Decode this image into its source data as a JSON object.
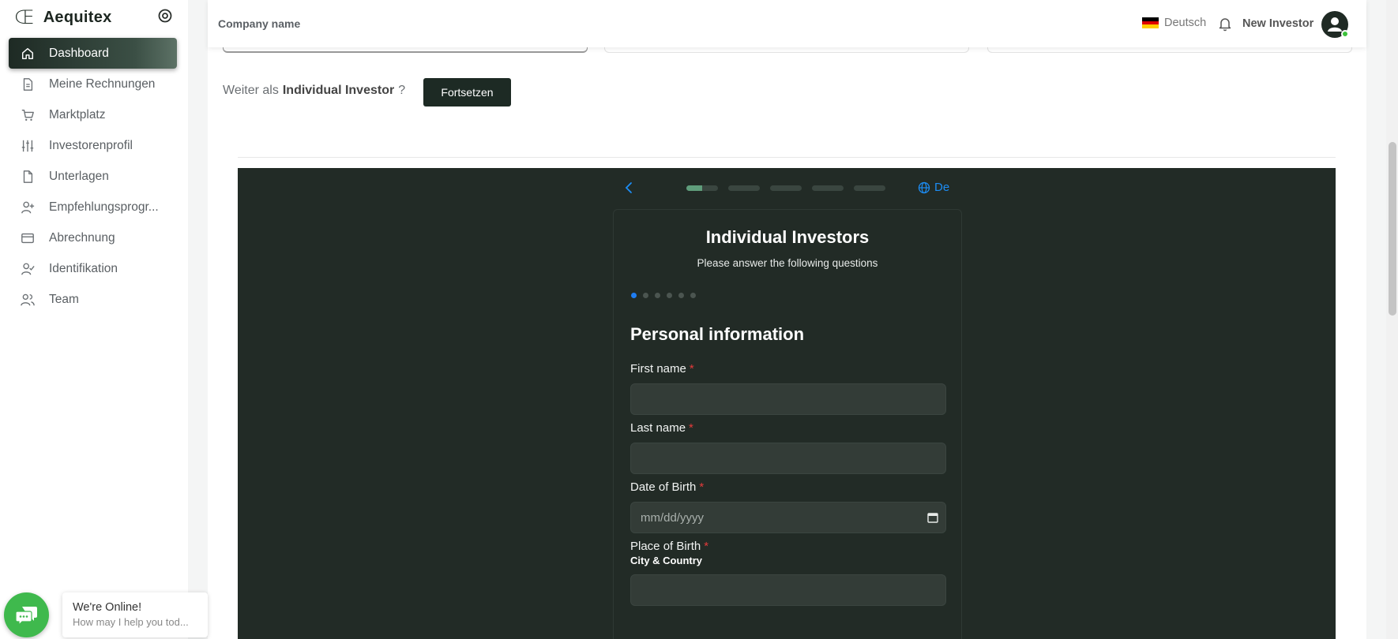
{
  "brand": {
    "logo": "Œ",
    "name": "Aequitex"
  },
  "sidebar": {
    "items": [
      {
        "key": "dashboard",
        "label": "Dashboard",
        "active": true
      },
      {
        "key": "invoices",
        "label": "Meine Rechnungen"
      },
      {
        "key": "marketplace",
        "label": "Marktplatz"
      },
      {
        "key": "investor-profile",
        "label": "Investorenprofil"
      },
      {
        "key": "documents",
        "label": "Unterlagen"
      },
      {
        "key": "referral",
        "label": "Empfehlungsprogr..."
      },
      {
        "key": "billing",
        "label": "Abrechnung"
      },
      {
        "key": "identification",
        "label": "Identifikation"
      },
      {
        "key": "team",
        "label": "Team"
      }
    ]
  },
  "header": {
    "company_label": "Company name",
    "language": "Deutsch",
    "user_name": "New Investor"
  },
  "continue": {
    "prefix": "Weiter als",
    "role": "Individual Investor",
    "suffix": "?",
    "button": "Fortsetzen"
  },
  "embed": {
    "language": "De",
    "progress_steps": [
      0.5,
      0,
      0,
      0,
      0
    ],
    "title": "Individual Investors",
    "subtitle": "Please answer the following questions",
    "page_dots": 6,
    "page_active": 1,
    "section_title": "Personal information",
    "fields": {
      "first_name": {
        "label": "First name",
        "required_mark": "*"
      },
      "last_name": {
        "label": "Last name",
        "required_mark": "*"
      },
      "dob": {
        "label": "Date of Birth",
        "required_mark": "*",
        "placeholder": "mm/dd/yyyy"
      },
      "pob": {
        "label": "Place of Birth",
        "required_mark": "*",
        "hint": "City & Country"
      }
    }
  },
  "chat": {
    "title": "We're Online!",
    "message": "How may I help you tod..."
  },
  "colors": {
    "accent_dark": "#1d2a24",
    "embed_bg": "#222b26",
    "link_blue": "#1c8df5",
    "required_red": "#e23b3b",
    "chat_green": "#3fb94d"
  }
}
